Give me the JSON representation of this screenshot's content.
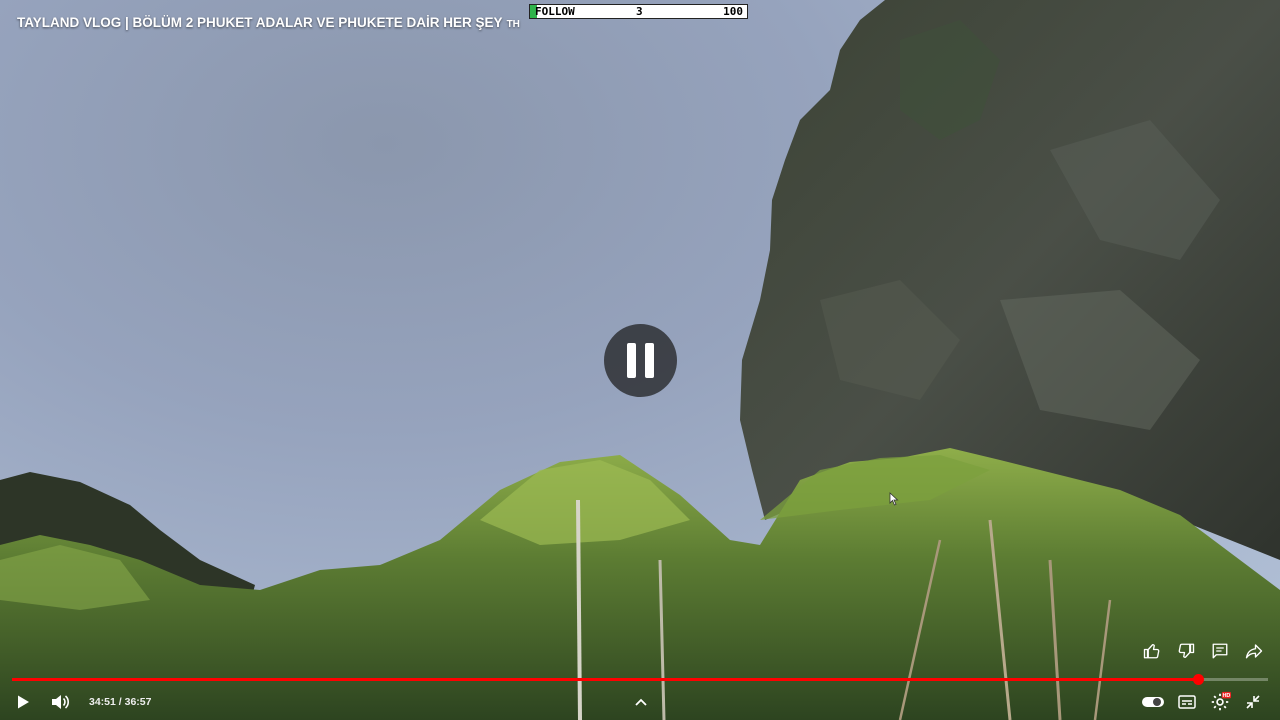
{
  "video": {
    "title": "TAYLAND VLOG | BÖLÜM 2 PHUKET ADALAR VE PHUKETE DAİR HER ŞEY",
    "title_suffix": "TH",
    "state": "paused"
  },
  "overlay": {
    "follow_label": "FOLLOW",
    "follow_count": "3",
    "follow_goal": "100",
    "follow_progress": 0.03,
    "accent": "#2fb34a"
  },
  "player": {
    "current_time": "34:51",
    "separator": " / ",
    "duration": "36:57",
    "played_fraction": 0.944,
    "progress_color": "#ff0000",
    "icons": {
      "play": "play-icon",
      "volume": "volume-icon",
      "chevron": "chevron-up-icon",
      "autoplay": "autoplay-toggle-icon",
      "subtitles": "subtitles-icon",
      "settings": "settings-icon",
      "settings_badge": "HD",
      "fullscreen_exit": "exit-fullscreen-icon"
    }
  },
  "actions": {
    "like": "thumbs-up-icon",
    "dislike": "thumbs-down-icon",
    "comment": "comment-icon",
    "share": "share-icon"
  }
}
